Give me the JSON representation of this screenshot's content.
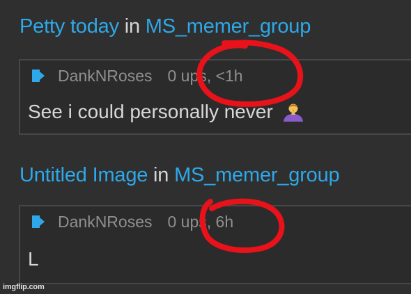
{
  "posts": [
    {
      "title": "Petty today",
      "connector": "in",
      "group": "MS_memer_group",
      "comment": {
        "username": "DankNRoses",
        "votes": "0 ups,",
        "time": "<1h",
        "text": "See i could personally never",
        "emoji": "person-bowing-hands-icon"
      }
    },
    {
      "title": "Untitled Image",
      "connector": "in",
      "group": "MS_memer_group",
      "comment": {
        "username": "DankNRoses",
        "votes": "0 ups,",
        "time": "6h",
        "text": "L"
      }
    }
  ],
  "watermark": "imgflip.com",
  "colors": {
    "background": "#2f2f2f",
    "link": "#2ea8e8",
    "text": "#d8d8d8",
    "meta": "#8f8f8f",
    "annotation": "#e8121a"
  }
}
